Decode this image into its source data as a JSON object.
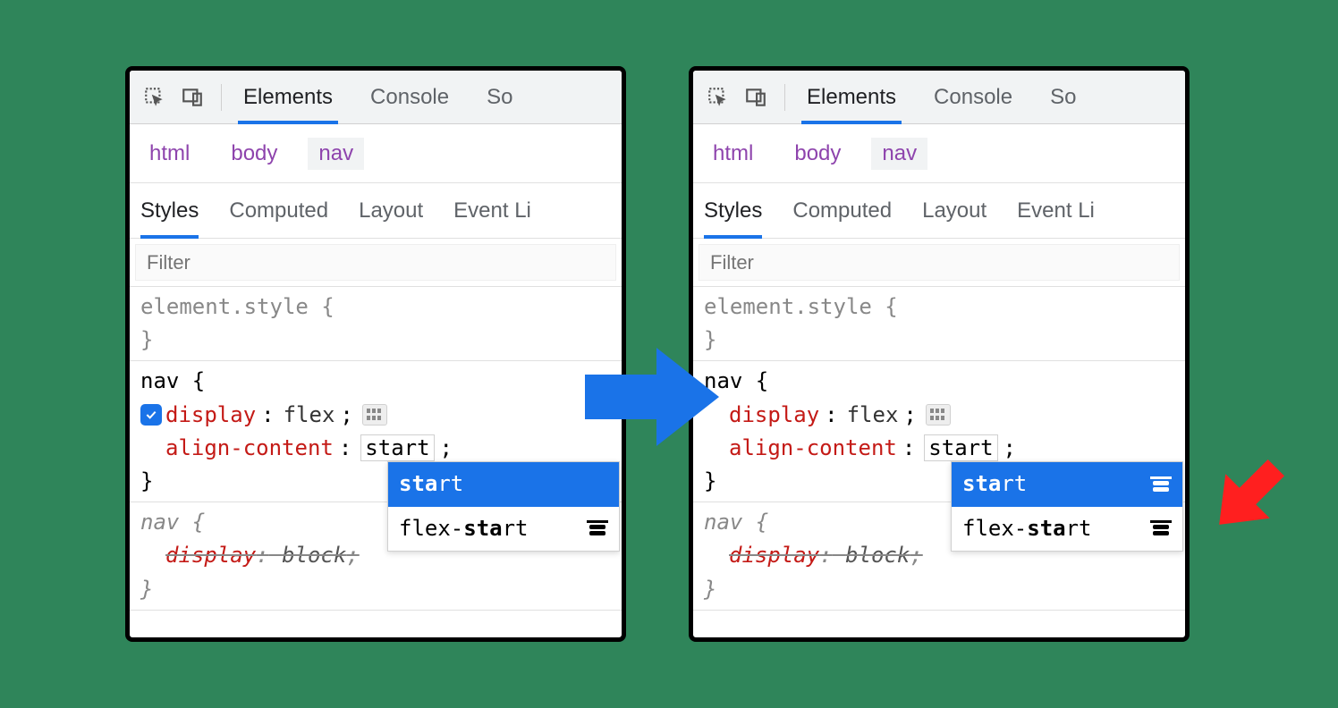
{
  "topTabs": {
    "elements": "Elements",
    "console": "Console",
    "sourcesFrag": "So"
  },
  "breadcrumb": {
    "html": "html",
    "body": "body",
    "nav": "nav"
  },
  "subTabs": {
    "styles": "Styles",
    "computed": "Computed",
    "layout": "Layout",
    "eventFrag": "Event Li"
  },
  "filter": {
    "placeholder": "Filter"
  },
  "rules": {
    "elementStyle": "element.style {",
    "close": "}",
    "navSel": "nav {",
    "displayProp": "display",
    "displayVal": "flex",
    "alignProp": "align-content",
    "alignVal": "start",
    "semi": ";",
    "colon": ":",
    "inheritedSel": "nav {",
    "inheritedProp": "display",
    "inheritedVal": "block"
  },
  "autocomplete": {
    "opt1_bold": "sta",
    "opt1_rest": "rt",
    "opt2_pre": "flex-",
    "opt2_bold": "sta",
    "opt2_rest": "rt"
  }
}
